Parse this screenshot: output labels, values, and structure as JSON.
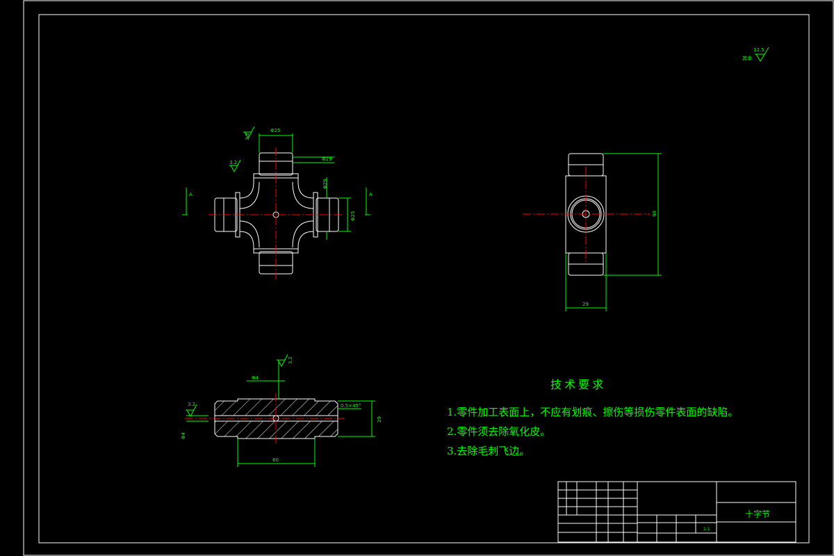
{
  "drawing": {
    "background": "#000000",
    "line_color": "#ffffff",
    "center_line_color": "#ff0000",
    "dimension_color": "#00ff00"
  },
  "roughness_general": {
    "value": "12.5",
    "label": "其余"
  },
  "roughness": {
    "r1": "3.2",
    "r2": "3.2",
    "r3": "3.2",
    "r4": "3.2"
  },
  "front_view": {
    "dim_top": "Φ25",
    "dim_right_top": "Φ29",
    "dim_right_v1": "Φ29",
    "dim_right_v2": "Φ25",
    "section_mark_left": "A",
    "section_mark_right": "A"
  },
  "side_view": {
    "dim_height": "90",
    "dim_width": "29"
  },
  "section_view": {
    "dim_hole": "Φ4",
    "dim_chamfer": "0.5×45°",
    "dim_height": "29",
    "dim_length": "60",
    "dim_left": "Φ4"
  },
  "tech_requirements": {
    "title": "技术要求",
    "items": [
      "1.零件加工表面上，不应有划痕、擦伤等损伤零件表面的缺陷。",
      "2.零件须去除氧化皮。",
      "3.去除毛刺飞边。"
    ]
  },
  "title_block": {
    "part_name": "十字节",
    "scale": "1:1"
  }
}
